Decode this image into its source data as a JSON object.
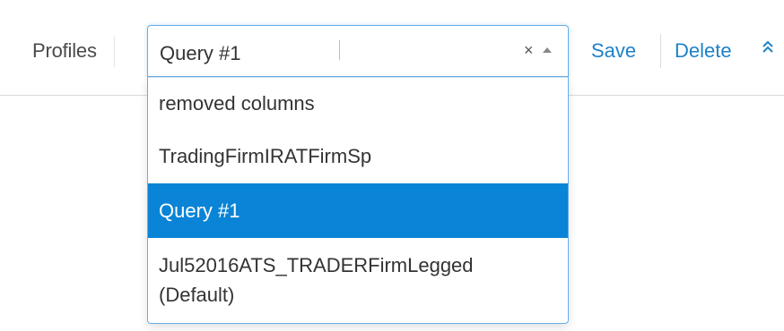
{
  "toolbar": {
    "profiles_label": "Profiles",
    "save_label": "Save",
    "delete_label": "Delete",
    "collapse_icon": "double-chevron-up-icon",
    "link_color": "#1d82c9"
  },
  "profile_select": {
    "value": "Query #1",
    "clear_icon": "×",
    "toggle_icon": "caret-up-icon",
    "options": [
      {
        "label": "removed columns",
        "selected": false
      },
      {
        "label": "TradingFirmIRATFirmSp",
        "selected": false
      },
      {
        "label": "Query #1",
        "selected": true
      },
      {
        "label_line1": "Jul52016ATS_TRADERFirmLegged",
        "label_line2": "(Default)",
        "selected": false
      }
    ],
    "selected_color": "#0a84d6"
  }
}
